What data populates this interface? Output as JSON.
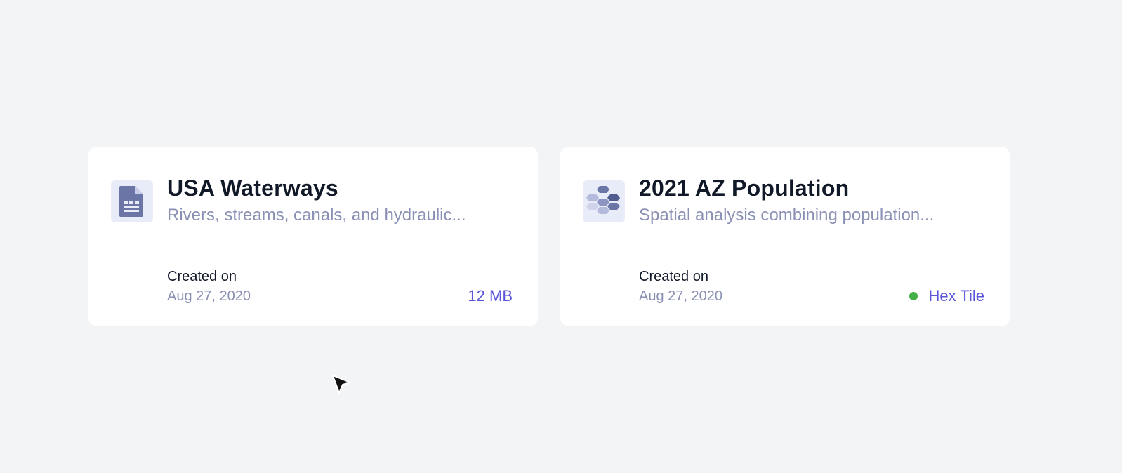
{
  "cards": [
    {
      "title": "USA Waterways",
      "description": "Rivers, streams, canals, and hydraulic...",
      "created_label": "Created on",
      "created_date": "Aug 27, 2020",
      "meta": "12 MB",
      "icon": "document-icon"
    },
    {
      "title": "2021 AZ Population",
      "description": "Spatial analysis combining population...",
      "created_label": "Created on",
      "created_date": "Aug 27, 2020",
      "meta": "Hex Tile",
      "icon": "hex-tile-icon",
      "status_color": "#43b047"
    }
  ],
  "colors": {
    "background": "#f3f4f6",
    "card": "#ffffff",
    "accent": "#5a56d8",
    "muted": "#8a90b4",
    "icon_fg": "#6b76a6",
    "icon_bg": "#e8ebf8"
  }
}
